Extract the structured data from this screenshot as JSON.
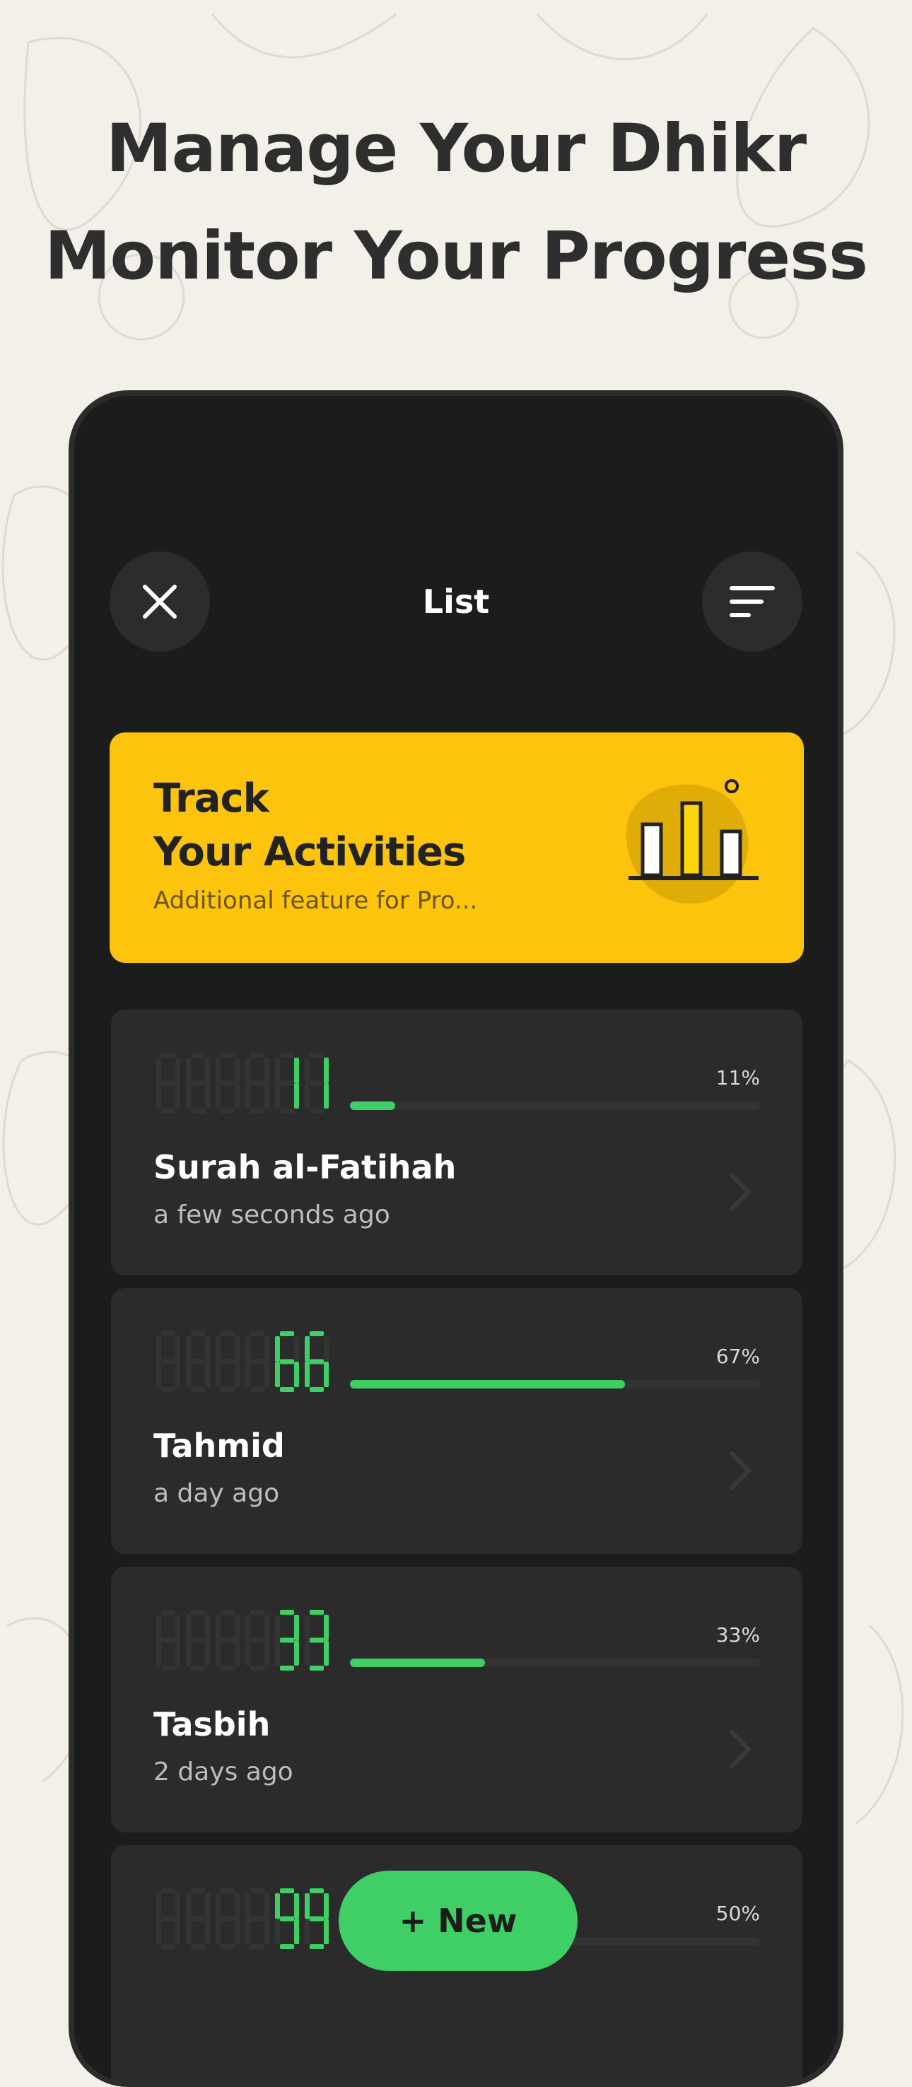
{
  "headline": {
    "line1": "Manage Your Dhikr",
    "line2": "Monitor Your Progress"
  },
  "topbar": {
    "title": "List",
    "close_icon": "close-icon",
    "filter_icon": "filter-sort-icon"
  },
  "banner": {
    "title_line1": "Track",
    "title_line2": "Your Activities",
    "subtitle": "Additional feature for Pro...",
    "icon": "bar-chart-icon",
    "color": "#fcc40d"
  },
  "cards": [
    {
      "count": "11",
      "percent_label": "11%",
      "progress": 0.11,
      "name": "Surah al-Fatihah",
      "time": "a few seconds ago"
    },
    {
      "count": "66",
      "percent_label": "67%",
      "progress": 0.67,
      "name": "Tahmid",
      "time": "a day ago"
    },
    {
      "count": "33",
      "percent_label": "33%",
      "progress": 0.33,
      "name": "Tasbih",
      "time": "2 days ago"
    },
    {
      "count": "99",
      "percent_label": "50%",
      "progress": 0.5,
      "name": "",
      "time": ""
    }
  ],
  "fab": {
    "label": "+ New"
  },
  "colors": {
    "accent": "#3fcf66",
    "background": "#1b1c1c",
    "card": "#2b2b2b"
  }
}
